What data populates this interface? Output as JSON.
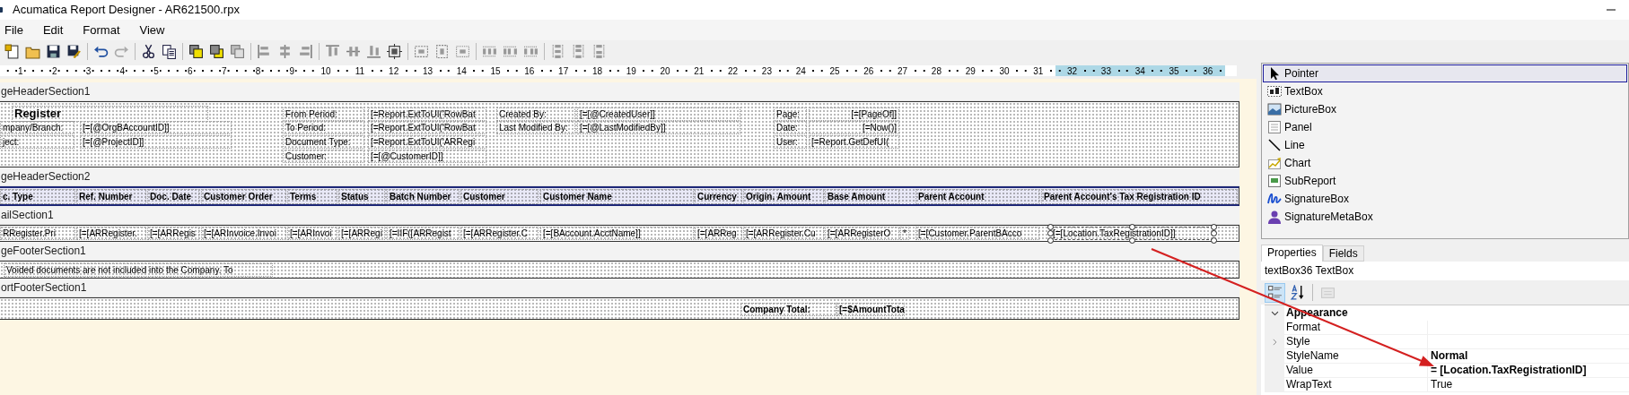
{
  "window": {
    "title": "Acumatica Report Designer - AR621500.rpx"
  },
  "menu": [
    "File",
    "Edit",
    "Format",
    "View"
  ],
  "ruler": {
    "marks": [
      {
        "label": "1",
        "selected": false
      },
      {
        "label": "2",
        "selected": false
      },
      {
        "label": "3",
        "selected": false
      },
      {
        "label": "4",
        "selected": false
      },
      {
        "label": "5",
        "selected": false
      },
      {
        "label": "6",
        "selected": false
      },
      {
        "label": "7",
        "selected": false
      },
      {
        "label": "8",
        "selected": false
      },
      {
        "label": "9",
        "selected": false
      },
      {
        "label": "10",
        "selected": false
      },
      {
        "label": "11",
        "selected": false
      },
      {
        "label": "12",
        "selected": false
      },
      {
        "label": "13",
        "selected": false
      },
      {
        "label": "14",
        "selected": false
      },
      {
        "label": "15",
        "selected": false
      },
      {
        "label": "16",
        "selected": false
      },
      {
        "label": "17",
        "selected": false
      },
      {
        "label": "18",
        "selected": false
      },
      {
        "label": "19",
        "selected": false
      },
      {
        "label": "20",
        "selected": false
      },
      {
        "label": "21",
        "selected": false
      },
      {
        "label": "22",
        "selected": false
      },
      {
        "label": "23",
        "selected": false
      },
      {
        "label": "24",
        "selected": false
      },
      {
        "label": "25",
        "selected": false
      },
      {
        "label": "26",
        "selected": false
      },
      {
        "label": "27",
        "selected": false
      },
      {
        "label": "28",
        "selected": false
      },
      {
        "label": "29",
        "selected": false
      },
      {
        "label": "30",
        "selected": false
      },
      {
        "label": "31",
        "selected": false
      },
      {
        "label": "32",
        "selected": true
      },
      {
        "label": "33",
        "selected": true
      },
      {
        "label": "34",
        "selected": true
      },
      {
        "label": "35",
        "selected": true
      },
      {
        "label": "36",
        "selected": true
      }
    ]
  },
  "sections": [
    {
      "title": "geHeaderSection1",
      "kind": "page_header",
      "fields": [
        {
          "text": "Register",
          "bold": true,
          "selected": false
        },
        {
          "text": "From Period:",
          "selected": false
        },
        {
          "text": "[=Report.ExtToUI('RowBat",
          "selected": false
        },
        {
          "text": "Created By:",
          "selected": false
        },
        {
          "text": "[=[@CreatedUser]]",
          "selected": false
        },
        {
          "text": "Page:",
          "selected": false
        },
        {
          "text": "[=[PageOf]]",
          "right_aligned": true,
          "selected": false
        },
        {
          "text": "mpany/Branch:",
          "selected": false
        },
        {
          "text": "[=[@OrgBAccountID]]",
          "selected": false
        },
        {
          "text": "To Period:",
          "selected": false
        },
        {
          "text": "[=Report.ExtToUI('RowBat",
          "selected": false
        },
        {
          "text": "Last Modified By:",
          "selected": false
        },
        {
          "text": "[=[@LastModifiedBy]]",
          "selected": false
        },
        {
          "text": "Date:",
          "selected": false
        },
        {
          "text": "[=Now()]",
          "right_aligned": true,
          "selected": false
        },
        {
          "text": "ject:",
          "selected": false
        },
        {
          "text": "[=[@ProjectID]]",
          "selected": false
        },
        {
          "text": "Document Type:",
          "selected": false
        },
        {
          "text": "[=Report.ExtToUI('ARRegi",
          "selected": false
        },
        {
          "text": "User:",
          "selected": false
        },
        {
          "text": "[=Report.GetDefUI(",
          "selected": false
        },
        {
          "text": "Customer:",
          "selected": false
        },
        {
          "text": "[=[@CustomerID]]",
          "selected": false
        }
      ]
    },
    {
      "title": "geHeaderSection2",
      "kind": "column_header",
      "fields": [
        {
          "text": "c. Type",
          "selected": false
        },
        {
          "text": "Ref. Number",
          "selected": false
        },
        {
          "text": "Doc. Date",
          "selected": false
        },
        {
          "text": "Customer Order",
          "selected": false
        },
        {
          "text": "Terms",
          "selected": false
        },
        {
          "text": "Status",
          "selected": false
        },
        {
          "text": "Batch Number",
          "selected": false
        },
        {
          "text": "Customer",
          "selected": false
        },
        {
          "text": "Customer Name",
          "selected": false
        },
        {
          "text": "Currency",
          "selected": false
        },
        {
          "text": "Origin. Amount",
          "selected": false
        },
        {
          "text": "Base Amount",
          "selected": false
        },
        {
          "text": "Parent Account",
          "selected": false
        },
        {
          "text": "Parent Account's Tax Registration ID",
          "selected": false
        }
      ]
    },
    {
      "title": "ailSection1",
      "kind": "detail",
      "fields": [
        {
          "text": "RRegister.Pri",
          "selected": false
        },
        {
          "text": "[=[ARRegister.",
          "selected": false
        },
        {
          "text": "[=[ARRegis",
          "selected": false
        },
        {
          "text": "[=[ARInvoice.Invoi",
          "selected": false
        },
        {
          "text": "[=[ARInvoi",
          "selected": false
        },
        {
          "text": "[=[ARRegi",
          "selected": false
        },
        {
          "text": "[=IIF([ARRegist",
          "selected": false
        },
        {
          "text": "[=[ARRegister.C",
          "selected": false
        },
        {
          "text": "[=[BAccount.AcctName]]",
          "selected": false
        },
        {
          "text": "[=[ARReg",
          "selected": false
        },
        {
          "text": "[=[ARRegister.Cu",
          "selected": false
        },
        {
          "text": "[=[ARRegisterO",
          "selected": false
        },
        {
          "text": "*",
          "selected": false
        },
        {
          "text": "[=[Customer.ParentBAcco",
          "selected": false
        },
        {
          "text": "[=[Location.TaxRegistrationID]]",
          "selected": true
        }
      ]
    },
    {
      "title": "geFooterSection1",
      "kind": "page_footer",
      "fields": [
        {
          "text": "Voided documents are not included into the Company. To",
          "selected": false
        }
      ]
    },
    {
      "title": "ortFooterSection1",
      "kind": "report_footer",
      "fields": [
        {
          "text": "Company Total:",
          "bold": true,
          "selected": false
        },
        {
          "text": "[=$AmountTota",
          "bold": true,
          "selected": false
        }
      ]
    }
  ],
  "toolbox": {
    "items": [
      {
        "label": "Pointer",
        "kind": "pointer",
        "selected": true
      },
      {
        "label": "TextBox",
        "kind": "textbox",
        "selected": false
      },
      {
        "label": "PictureBox",
        "kind": "picturebox",
        "selected": false
      },
      {
        "label": "Panel",
        "kind": "panel",
        "selected": false
      },
      {
        "label": "Line",
        "kind": "line",
        "selected": false
      },
      {
        "label": "Chart",
        "kind": "chart",
        "selected": false
      },
      {
        "label": "SubReport",
        "kind": "subreport",
        "selected": false
      },
      {
        "label": "SignatureBox",
        "kind": "signaturebox",
        "selected": false
      },
      {
        "label": "SignatureMetaBox",
        "kind": "signaturemetabox",
        "selected": false
      }
    ]
  },
  "properties": {
    "tabs": [
      {
        "label": "Properties",
        "selected": true
      },
      {
        "label": "Fields",
        "selected": false
      }
    ],
    "object": "textBox36 TextBox",
    "view_buttons": [
      {
        "kind": "categorized",
        "selected": true,
        "disabled": false
      },
      {
        "kind": "alphabetical",
        "selected": false,
        "disabled": false
      },
      {
        "kind": "property_pages",
        "selected": false,
        "disabled": true
      }
    ],
    "categories": [
      {
        "name": "Appearance",
        "expanded": true,
        "rows": [
          {
            "name": "Format",
            "kind": "value"
          },
          {
            "name": "Style",
            "kind": "expandable"
          },
          {
            "name": "StyleName",
            "kind": "value",
            "value": "Normal",
            "modified": true
          },
          {
            "name": "Value",
            "kind": "value",
            "value": "= [Location.TaxRegistrationID]",
            "modified": true
          },
          {
            "name": "WrapText",
            "kind": "value",
            "value": "True",
            "modified": false
          }
        ]
      }
    ]
  }
}
